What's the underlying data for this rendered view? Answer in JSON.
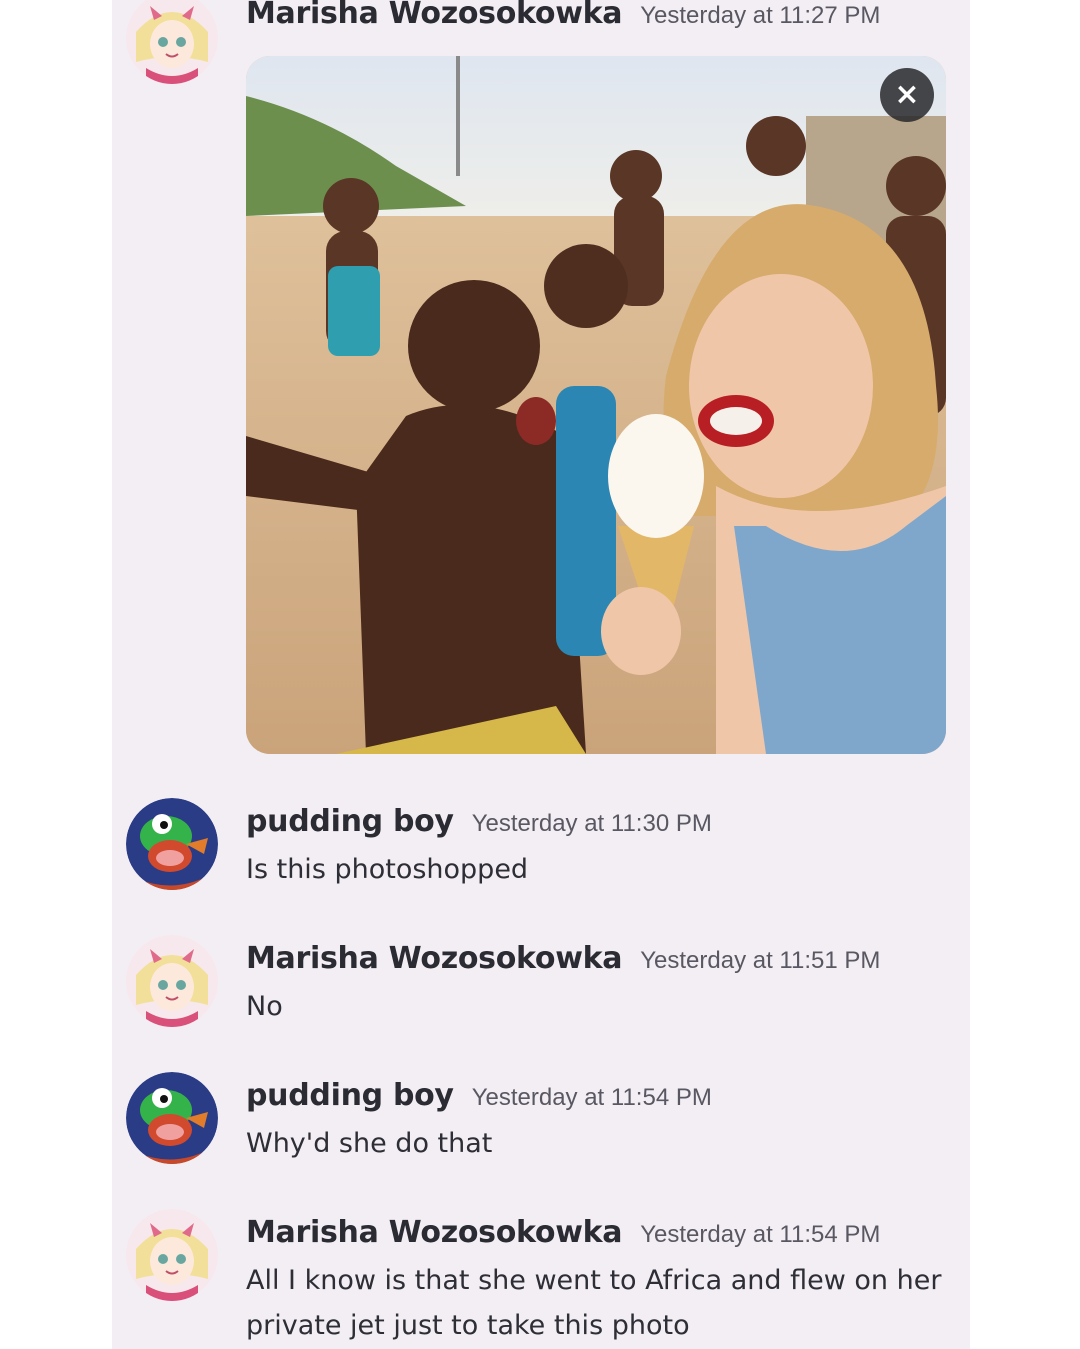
{
  "messages": [
    {
      "author": "Marisha Wozosokowka",
      "timestamp": "Yesterday at 11:27 PM",
      "text": "",
      "avatar_icon": "anime-girl-avatar-icon",
      "attachment": {
        "image": "photo-attachment",
        "close_symbol": "×",
        "close_icon": "close-icon"
      }
    },
    {
      "author": "pudding boy",
      "timestamp": "Yesterday at 11:30 PM",
      "text": "Is this photoshopped",
      "avatar_icon": "green-dinosaur-avatar-icon"
    },
    {
      "author": "Marisha Wozosokowka",
      "timestamp": "Yesterday at 11:51 PM",
      "text": "No",
      "avatar_icon": "anime-girl-avatar-icon"
    },
    {
      "author": "pudding boy",
      "timestamp": "Yesterday at 11:54 PM",
      "text": "Why'd she do that",
      "avatar_icon": "green-dinosaur-avatar-icon"
    },
    {
      "author": "Marisha Wozosokowka",
      "timestamp": "Yesterday at 11:54 PM",
      "text": "All I know is that she went to Africa and flew on her private jet just to take this photo",
      "avatar_icon": "anime-girl-avatar-icon"
    }
  ],
  "colors": {
    "chat_background": "#f3eef4",
    "username": "#2b2b33",
    "timestamp": "#595862",
    "message_text": "#2e2e36"
  }
}
